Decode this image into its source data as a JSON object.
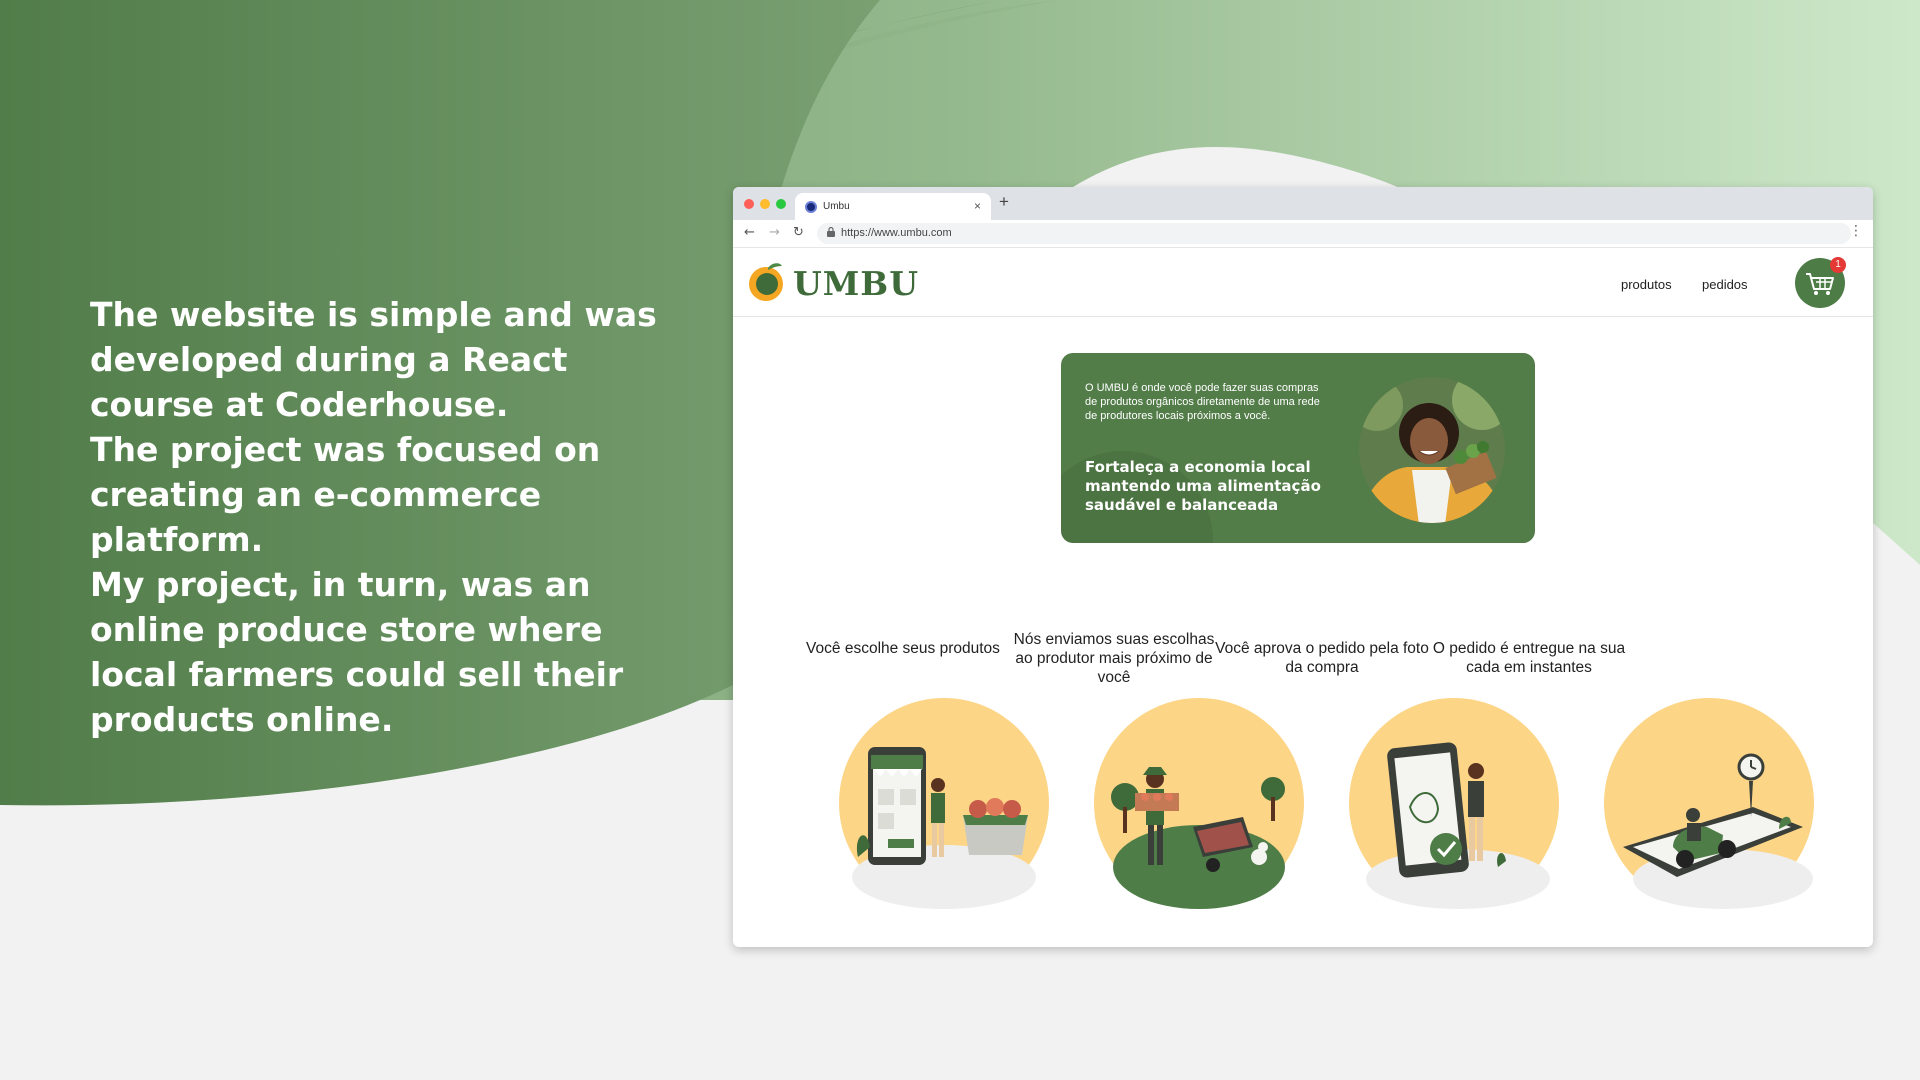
{
  "intro": {
    "p1": "The website is simple and was developed during a React course at Coderhouse.",
    "p2": "The project was focused on creating an e-commerce platform.",
    "p3": "My project, in turn, was an online produce store where local farmers could sell their products online."
  },
  "browser": {
    "tab_title": "Umbu",
    "tab_close": "×",
    "new_tab": "+",
    "url": "https://www.umbu.com",
    "back": "←",
    "forward": "→",
    "reload": "↻",
    "menu": "⋮"
  },
  "site": {
    "logo_text": "UMBU",
    "nav": {
      "products": "produtos",
      "orders": "pedidos"
    },
    "cart_count": "1",
    "hero": {
      "intro": "O UMBU é onde você pode fazer suas compras de produtos orgânicos diretamente de uma rede de produtores locais próximos a você.",
      "headline": "Fortaleça a economia local mantendo uma alimentação saudável e balanceada"
    },
    "steps": [
      {
        "label": "Você escolhe seus produtos",
        "icon": "phone-shop-basket-illustration"
      },
      {
        "label": "Nós enviamos  suas escolhas ao produtor mais próximo de você",
        "icon": "farmer-wheelbarrow-illustration"
      },
      {
        "label": "Você aprova o pedido pela foto da compra",
        "icon": "phone-approval-illustration"
      },
      {
        "label": "O pedido é entregue na sua cada em instantes",
        "icon": "scooter-delivery-illustration"
      }
    ]
  },
  "colors": {
    "dark_green": "#4f7d48",
    "light_green": "#cde8c9",
    "illustration_yellow": "#fdd587",
    "accent_orange": "#f5a623"
  }
}
